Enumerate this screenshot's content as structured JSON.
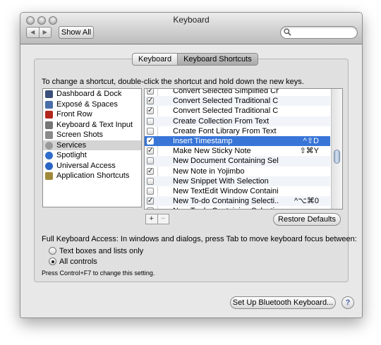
{
  "window": {
    "title": "Keyboard"
  },
  "toolbar": {
    "back": "◀",
    "forward": "▶",
    "show_all": "Show All",
    "search_value": ""
  },
  "tabs": [
    {
      "label": "Keyboard",
      "active": false
    },
    {
      "label": "Keyboard Shortcuts",
      "active": true
    }
  ],
  "instructions": "To change a shortcut, double-click the shortcut and hold down the new keys.",
  "categories": [
    {
      "label": "Dashboard & Dock",
      "icon": "dashboard-icon",
      "color": "#3b4f7a"
    },
    {
      "label": "Exposé & Spaces",
      "icon": "expose-icon",
      "color": "#4a6fa8"
    },
    {
      "label": "Front Row",
      "icon": "front-row-icon",
      "color": "#b3261e"
    },
    {
      "label": "Keyboard & Text Input",
      "icon": "keyboard-icon",
      "color": "#777777"
    },
    {
      "label": "Screen Shots",
      "icon": "screenshot-icon",
      "color": "#8a8a8a"
    },
    {
      "label": "Services",
      "icon": "gear-icon",
      "color": "#9a9a9a",
      "selected": true
    },
    {
      "label": "Spotlight",
      "icon": "spotlight-icon",
      "color": "#2f6dc9"
    },
    {
      "label": "Universal Access",
      "icon": "accessibility-icon",
      "color": "#2a64c4"
    },
    {
      "label": "Application Shortcuts",
      "icon": "app-shortcuts-icon",
      "color": "#a08a3a"
    }
  ],
  "services": [
    {
      "checked": true,
      "name": "Convert Selected Simplified Ch...",
      "key": ""
    },
    {
      "checked": true,
      "name": "Convert Selected Traditional C...",
      "key": ""
    },
    {
      "checked": true,
      "name": "Convert Selected Traditional C...",
      "key": ""
    },
    {
      "checked": false,
      "name": "Create Collection From Text",
      "key": ""
    },
    {
      "checked": false,
      "name": "Create Font Library From Text",
      "key": ""
    },
    {
      "checked": true,
      "name": "Insert Timestamp",
      "key": "^⇧D",
      "selected": true
    },
    {
      "checked": true,
      "name": "Make New Sticky Note",
      "key": "⇧⌘Y"
    },
    {
      "checked": false,
      "name": "New Document Containing Sele...",
      "key": ""
    },
    {
      "checked": true,
      "name": "New Note in Yojimbo",
      "key": ""
    },
    {
      "checked": false,
      "name": "New Snippet With Selection",
      "key": ""
    },
    {
      "checked": false,
      "name": "New TextEdit Window Containi...",
      "key": ""
    },
    {
      "checked": true,
      "name": "New To-do Containing Selecti...",
      "key": "^⌥⌘0"
    },
    {
      "checked": false,
      "name": "New To-do Containing Selecti...",
      "key": ""
    }
  ],
  "buttons": {
    "add": "+",
    "remove": "−",
    "restore_defaults": "Restore Defaults",
    "bluetooth": "Set Up Bluetooth Keyboard...",
    "help": "?"
  },
  "full_keyboard_access": {
    "label": "Full Keyboard Access: In windows and dialogs, press Tab to move keyboard focus between:",
    "options": [
      {
        "label": "Text boxes and lists only",
        "selected": false
      },
      {
        "label": "All controls",
        "selected": true
      }
    ],
    "note": "Press Control+F7 to change this setting."
  },
  "colors": {
    "selection": "#3875d7",
    "window_bg": "#e8e8e8"
  }
}
